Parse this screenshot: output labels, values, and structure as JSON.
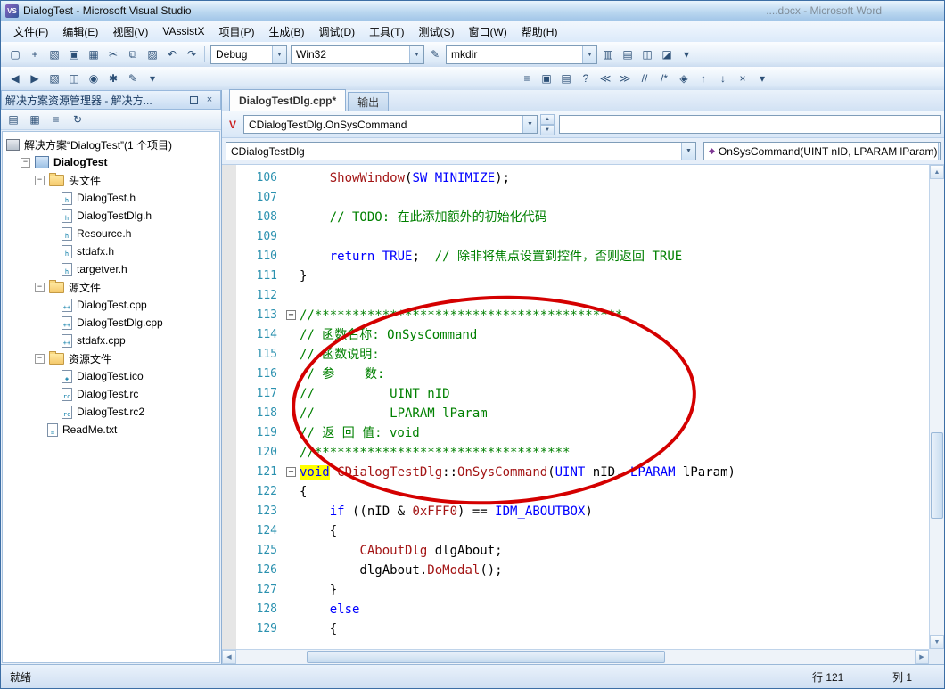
{
  "window": {
    "title": "DialogTest - Microsoft Visual Studio",
    "background_window": "....docx - Microsoft Word"
  },
  "menu_items": [
    "文件(F)",
    "编辑(E)",
    "视图(V)",
    "VAssistX",
    "项目(P)",
    "生成(B)",
    "调试(D)",
    "工具(T)",
    "测试(S)",
    "窗口(W)",
    "帮助(H)"
  ],
  "toolbar1": {
    "icons_a": [
      {
        "name": "new-file",
        "g": "▢"
      },
      {
        "name": "add-item",
        "g": "+"
      },
      {
        "name": "open-file",
        "g": "▧"
      },
      {
        "name": "save",
        "g": "▣"
      },
      {
        "name": "save-all",
        "g": "▦"
      },
      {
        "name": "cut",
        "g": "✂"
      },
      {
        "name": "copy",
        "g": "⧉"
      },
      {
        "name": "paste",
        "g": "▨"
      },
      {
        "name": "undo",
        "g": "↶"
      },
      {
        "name": "redo",
        "g": "↷"
      }
    ],
    "debug_combo": "Debug",
    "platform_combo": "Win32",
    "find_combo": "mkdir",
    "icons_b": [
      {
        "name": "find-in-files",
        "g": "▥"
      },
      {
        "name": "properties-window",
        "g": "▤"
      },
      {
        "name": "solution-explorer-toggle",
        "g": "◫"
      },
      {
        "name": "object-browser",
        "g": "◪"
      },
      {
        "name": "toolbar-options",
        "g": "▾"
      }
    ]
  },
  "toolbar2": {
    "left_icons": [
      {
        "name": "va-nav-back",
        "g": "◀"
      },
      {
        "name": "va-nav-forward",
        "g": "▶"
      },
      {
        "name": "va-open-file-in-solution",
        "g": "▧"
      },
      {
        "name": "va-open-corresponding-file",
        "g": "◫"
      },
      {
        "name": "va-find-symbol",
        "g": "◉"
      },
      {
        "name": "va-find-references",
        "g": "✱"
      },
      {
        "name": "va-refactor-menu",
        "g": "✎"
      },
      {
        "name": "va-options",
        "g": "▾"
      }
    ],
    "right_icons": [
      {
        "name": "member-list",
        "g": "≡"
      },
      {
        "name": "word-completion",
        "g": "▣"
      },
      {
        "name": "parameter-info",
        "g": "▤"
      },
      {
        "name": "quick-info",
        "g": "?"
      },
      {
        "name": "decrease-indent",
        "g": "≪"
      },
      {
        "name": "increase-indent",
        "g": "≫"
      },
      {
        "name": "comment-selection",
        "g": "//"
      },
      {
        "name": "uncomment-selection",
        "g": "/*"
      },
      {
        "name": "toggle-bookmark",
        "g": "◈"
      },
      {
        "name": "previous-bookmark",
        "g": "↑"
      },
      {
        "name": "next-bookmark",
        "g": "↓"
      },
      {
        "name": "clear-bookmarks",
        "g": "×"
      },
      {
        "name": "toolbar-options",
        "g": "▾"
      }
    ]
  },
  "solution_explorer": {
    "title": "解决方案资源管理器 - 解决方...",
    "toolbar_icons": [
      {
        "name": "properties",
        "g": "▤"
      },
      {
        "name": "show-all-files",
        "g": "▦"
      },
      {
        "name": "view-code",
        "g": "≡"
      },
      {
        "name": "refresh",
        "g": "↻"
      }
    ],
    "tree": {
      "root": "解决方案“DialogTest”(1 个项目)",
      "project": "DialogTest",
      "children": [
        {
          "type": "folder",
          "label": "头文件",
          "children": [
            {
              "kind": "h",
              "label": "DialogTest.h"
            },
            {
              "kind": "h",
              "label": "DialogTestDlg.h"
            },
            {
              "kind": "h",
              "label": "Resource.h"
            },
            {
              "kind": "h",
              "label": "stdafx.h"
            },
            {
              "kind": "h",
              "label": "targetver.h"
            }
          ]
        },
        {
          "type": "folder",
          "label": "源文件",
          "children": [
            {
              "kind": "cpp",
              "label": "DialogTest.cpp"
            },
            {
              "kind": "cpp",
              "label": "DialogTestDlg.cpp"
            },
            {
              "kind": "cpp",
              "label": "stdafx.cpp"
            }
          ]
        },
        {
          "type": "folder",
          "label": "资源文件",
          "children": [
            {
              "kind": "ico",
              "label": "DialogTest.ico"
            },
            {
              "kind": "rc",
              "label": "DialogTest.rc"
            },
            {
              "kind": "rc",
              "label": "DialogTest.rc2"
            }
          ]
        },
        {
          "type": "file",
          "kind": "txt",
          "label": "ReadMe.txt"
        }
      ]
    }
  },
  "editor": {
    "tabs": [
      {
        "label": "DialogTestDlg.cpp*",
        "active": true
      },
      {
        "label": "输出",
        "active": false
      }
    ],
    "vax_combo": "CDialogTestDlg.OnSysCommand",
    "type_combo": "CDialogTestDlg",
    "member_combo": "OnSysCommand(UINT nID, LPARAM lParam)",
    "lines": [
      {
        "n": 106,
        "fold": false,
        "segs": [
          [
            "t",
            "    "
          ],
          [
            "f",
            "ShowWindow"
          ],
          [
            "t",
            "("
          ],
          [
            "k",
            "SW_MINIMIZE"
          ],
          [
            "t",
            ");"
          ]
        ]
      },
      {
        "n": 107,
        "fold": false,
        "segs": []
      },
      {
        "n": 108,
        "fold": false,
        "segs": [
          [
            "t",
            "    "
          ],
          [
            "c",
            "// TODO: 在此添加额外的初始化代码"
          ]
        ]
      },
      {
        "n": 109,
        "fold": false,
        "segs": []
      },
      {
        "n": 110,
        "fold": false,
        "segs": [
          [
            "t",
            "    "
          ],
          [
            "k",
            "return"
          ],
          [
            "t",
            " "
          ],
          [
            "k",
            "TRUE"
          ],
          [
            "t",
            ";  "
          ],
          [
            "c",
            "// 除非将焦点设置到控件，否则返回 TRUE"
          ]
        ]
      },
      {
        "n": 111,
        "fold": false,
        "segs": [
          [
            "t",
            "}"
          ]
        ]
      },
      {
        "n": 112,
        "fold": false,
        "segs": []
      },
      {
        "n": 113,
        "fold": true,
        "segs": [
          [
            "c",
            "//*****************************************"
          ]
        ]
      },
      {
        "n": 114,
        "fold": false,
        "segs": [
          [
            "c",
            "// 函数名称: OnSysCommand"
          ]
        ]
      },
      {
        "n": 115,
        "fold": false,
        "segs": [
          [
            "c",
            "// 函数说明:"
          ]
        ]
      },
      {
        "n": 116,
        "fold": false,
        "segs": [
          [
            "c",
            "// 参    数:"
          ]
        ]
      },
      {
        "n": 117,
        "fold": false,
        "segs": [
          [
            "c",
            "//          UINT nID"
          ]
        ]
      },
      {
        "n": 118,
        "fold": false,
        "segs": [
          [
            "c",
            "//          LPARAM lParam"
          ]
        ]
      },
      {
        "n": 119,
        "fold": false,
        "segs": [
          [
            "c",
            "// 返 回 值: void"
          ]
        ]
      },
      {
        "n": 120,
        "fold": false,
        "segs": [
          [
            "c",
            "//**********************************"
          ]
        ]
      },
      {
        "n": 121,
        "fold": true,
        "segs": [
          [
            "hl",
            "void"
          ],
          [
            "t",
            " "
          ],
          [
            "f",
            "CDialogTestDlg"
          ],
          [
            "t",
            "::"
          ],
          [
            "f",
            "OnSysCommand"
          ],
          [
            "t",
            "("
          ],
          [
            "k",
            "UINT"
          ],
          [
            "t",
            " nID, "
          ],
          [
            "k",
            "LPARAM"
          ],
          [
            "t",
            " lParam)"
          ]
        ]
      },
      {
        "n": 122,
        "fold": false,
        "segs": [
          [
            "t",
            "{"
          ]
        ]
      },
      {
        "n": 123,
        "fold": false,
        "segs": [
          [
            "t",
            "    "
          ],
          [
            "k",
            "if"
          ],
          [
            "t",
            " ((nID & "
          ],
          [
            "f",
            "0xFFF0"
          ],
          [
            "t",
            ") == "
          ],
          [
            "k",
            "IDM_ABOUTBOX"
          ],
          [
            "t",
            ")"
          ]
        ]
      },
      {
        "n": 124,
        "fold": false,
        "segs": [
          [
            "t",
            "    {"
          ]
        ]
      },
      {
        "n": 125,
        "fold": false,
        "segs": [
          [
            "t",
            "        "
          ],
          [
            "f",
            "CAboutDlg"
          ],
          [
            "t",
            " dlgAbout;"
          ]
        ]
      },
      {
        "n": 126,
        "fold": false,
        "segs": [
          [
            "t",
            "        dlgAbout."
          ],
          [
            "f",
            "DoModal"
          ],
          [
            "t",
            "();"
          ]
        ]
      },
      {
        "n": 127,
        "fold": false,
        "segs": [
          [
            "t",
            "    }"
          ]
        ]
      },
      {
        "n": 128,
        "fold": false,
        "segs": [
          [
            "t",
            "    "
          ],
          [
            "k",
            "else"
          ]
        ]
      },
      {
        "n": 129,
        "fold": false,
        "segs": [
          [
            "t",
            "    {"
          ]
        ]
      }
    ]
  },
  "status": {
    "message": "就绪",
    "line_label": "行 121",
    "col_label": "列 1"
  },
  "colors": {
    "annotation": "#d40000",
    "keyword": "#0000ff",
    "comment": "#008000",
    "identifier_special": "#a31515",
    "line_number": "#2b91af",
    "highlight_bg": "#ffff00"
  }
}
